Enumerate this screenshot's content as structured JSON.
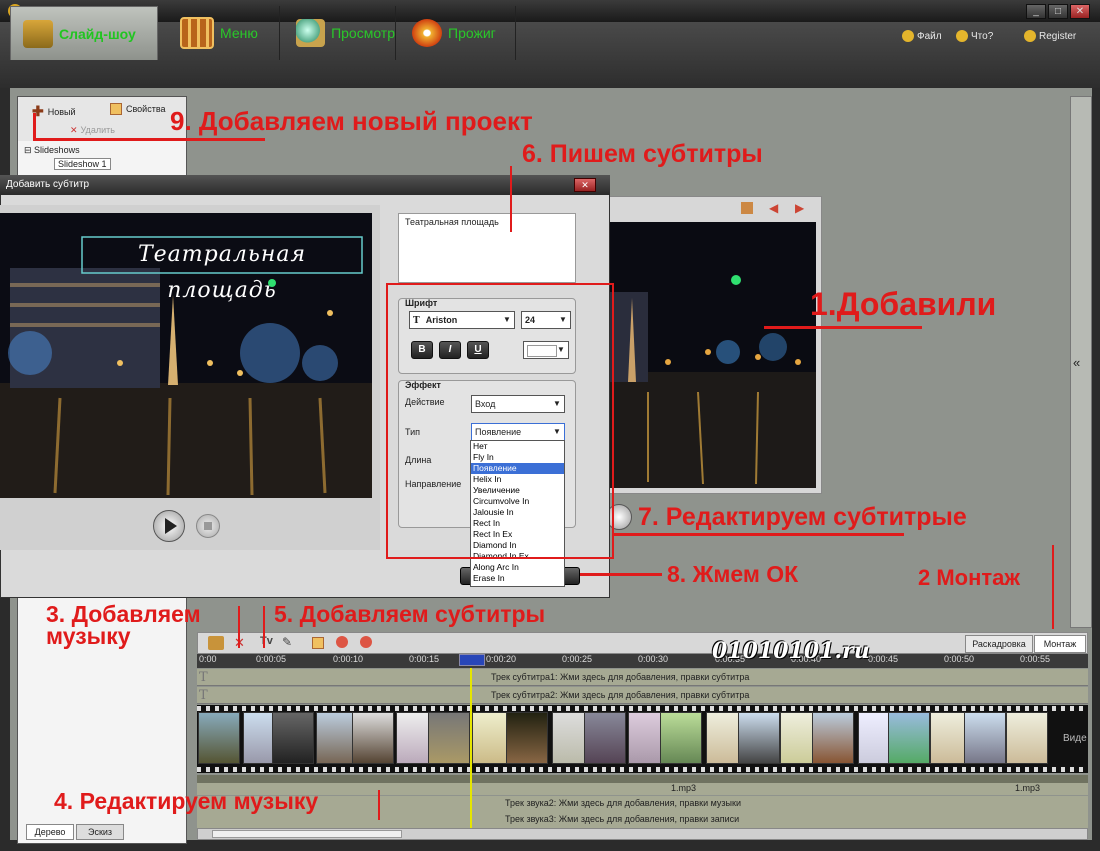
{
  "toolbar": {
    "tabs": [
      {
        "label": "Слайд-шоу"
      },
      {
        "label": "Меню"
      },
      {
        "label": "Просмотр"
      },
      {
        "label": "Прожиг"
      }
    ],
    "links": {
      "file": "Файл",
      "help": "Что?",
      "register": "Register"
    }
  },
  "left_panel": {
    "new_label": "Новый",
    "props_label": "Свойства",
    "delete_label": "Удалить",
    "tree_root": "Slideshows",
    "tree_item": "Slideshow 1",
    "bottom_tabs": [
      "Дерево",
      "Эскиз"
    ]
  },
  "dialog": {
    "title": "Добавить субтитр",
    "subtitle_text": "Театральная площадь",
    "overlay_caption": "Театральная площадь",
    "font_group": "Шрифт",
    "font_name": "Ariston",
    "font_size": "24",
    "bold": "B",
    "italic": "I",
    "underline": "U",
    "effect_group": "Эффект",
    "action_label": "Действие",
    "action_value": "Вход",
    "type_label": "Тип",
    "type_value": "Появление",
    "length_label": "Длина",
    "direction_label": "Направление",
    "type_options": [
      "Нет",
      "Fly In",
      "Появление",
      "Helix In",
      "Увеличение",
      "Circumvolve In",
      "Jalousie In",
      "Rect In",
      "Rect In Ex",
      "Diamond In",
      "Diamond In Ex",
      "Along Arc In",
      "Erase In"
    ]
  },
  "timeline": {
    "view_tabs": [
      "Раскадровка",
      "Монтаж"
    ],
    "ticks": [
      "0:00",
      "0:00:05",
      "0:00:10",
      "0:00:15",
      "0:00:20",
      "0:00:25",
      "0:00:30",
      "0:00:35",
      "0:00:40",
      "0:00:45",
      "0:00:50",
      "0:00:55"
    ],
    "sub_track1": "Трек субтитра1: Жми здесь для добавления, правки субтитра",
    "sub_track2": "Трек субтитра2: Жми здесь для добавления, правки субтитра",
    "video_label": "Виде",
    "mp3_a": "1.mp3",
    "mp3_b": "1.mp3",
    "audio_track2": "Трек звука2: Жми здесь для добавления, правки музыки",
    "audio_track3": "Трек звука3: Жми здесь для добавления, правки записи",
    "playhead_time": "0:00:20"
  },
  "watermark": "01010101.ru",
  "annotations": {
    "a1": "1.Добавили",
    "a2": "2 Монтаж",
    "a3": "3. Добавляем",
    "a3b": "музыку",
    "a4": "4. Редактируем музыку",
    "a5": "5. Добавляем субтитры",
    "a6": "6. Пишем субтитры",
    "a7": "7. Редактируем субтитрые",
    "a8": "8. Жмем ОК",
    "a9": "9. Добавляем новый проект"
  },
  "colors": {
    "annotation": "#e01b1b",
    "tab_text": "#29c829",
    "selection": "#3b6fd6",
    "playhead": "#e6e600"
  }
}
